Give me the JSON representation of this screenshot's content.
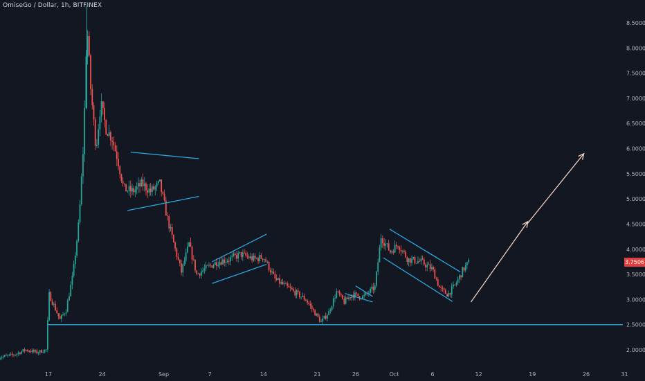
{
  "header": {
    "symbol_title": "OmiseGo / Dollar, 1h, BITFINEX"
  },
  "last_price": {
    "label": "3.7506",
    "value": 3.7506,
    "color": "#e03e3e"
  },
  "colors": {
    "background": "#131722",
    "up_candle": "#26a69a",
    "down_candle": "#ef5350",
    "trendline": "#2aa5e0",
    "projection_arrow": "#f0d0c0",
    "axis_text": "#b2b5be"
  },
  "chart_data": {
    "type": "candlestick",
    "title": "OmiseGo / Dollar, 1h, BITFINEX",
    "y_axis_ticks": [
      "2.0000",
      "2.5000",
      "3.0000",
      "3.5000",
      "4.0000",
      "4.5000",
      "5.0000",
      "5.5000",
      "6.0000",
      "6.5000",
      "7.0000",
      "7.5000",
      "8.0000",
      "8.5000"
    ],
    "y_axis_values": [
      2.0,
      2.5,
      3.0,
      3.5,
      4.0,
      4.5,
      5.0,
      5.5,
      6.0,
      6.5,
      7.0,
      7.5,
      8.0,
      8.5
    ],
    "ylim": [
      1.8,
      8.9
    ],
    "x_axis_ticks": [
      "17",
      "24",
      "Sep",
      "7",
      "14",
      "21",
      "26",
      "Oct",
      "6",
      "12",
      "19",
      "26",
      "31"
    ],
    "x_axis_day_index": [
      0,
      7,
      15,
      21,
      28,
      35,
      40,
      45,
      50,
      56,
      63,
      70,
      75
    ],
    "xlim_day_index": [
      -7,
      77
    ],
    "price_path": [
      {
        "d": -6.5,
        "p": 1.85
      },
      {
        "d": -4.5,
        "p": 1.9
      },
      {
        "d": -3,
        "p": 2.0
      },
      {
        "d": -1.5,
        "p": 1.95
      },
      {
        "d": -0.3,
        "p": 2.0
      },
      {
        "d": 0.1,
        "p": 3.1
      },
      {
        "d": 0.8,
        "p": 2.85
      },
      {
        "d": 1.5,
        "p": 2.6
      },
      {
        "d": 2.3,
        "p": 2.8
      },
      {
        "d": 3.2,
        "p": 3.5
      },
      {
        "d": 4.0,
        "p": 4.6
      },
      {
        "d": 4.6,
        "p": 6.2
      },
      {
        "d": 5.0,
        "p": 8.5
      },
      {
        "d": 5.5,
        "p": 7.2
      },
      {
        "d": 6.2,
        "p": 6.0
      },
      {
        "d": 6.8,
        "p": 6.9
      },
      {
        "d": 7.5,
        "p": 6.4
      },
      {
        "d": 8.3,
        "p": 6.2
      },
      {
        "d": 9.0,
        "p": 5.8
      },
      {
        "d": 9.8,
        "p": 5.2
      },
      {
        "d": 11,
        "p": 5.15
      },
      {
        "d": 12.2,
        "p": 5.3
      },
      {
        "d": 13.3,
        "p": 5.15
      },
      {
        "d": 14.5,
        "p": 5.3
      },
      {
        "d": 15.5,
        "p": 4.6
      },
      {
        "d": 16.5,
        "p": 4.0
      },
      {
        "d": 17.3,
        "p": 3.55
      },
      {
        "d": 18.3,
        "p": 4.1
      },
      {
        "d": 19.3,
        "p": 3.5
      },
      {
        "d": 20.3,
        "p": 3.6
      },
      {
        "d": 22,
        "p": 3.75
      },
      {
        "d": 23.5,
        "p": 3.8
      },
      {
        "d": 25,
        "p": 3.9
      },
      {
        "d": 26.8,
        "p": 3.8
      },
      {
        "d": 28,
        "p": 3.85
      },
      {
        "d": 29.5,
        "p": 3.4
      },
      {
        "d": 31.5,
        "p": 3.2
      },
      {
        "d": 33.5,
        "p": 3.0
      },
      {
        "d": 35.5,
        "p": 2.55
      },
      {
        "d": 36.5,
        "p": 2.75
      },
      {
        "d": 37.5,
        "p": 3.15
      },
      {
        "d": 38.5,
        "p": 2.95
      },
      {
        "d": 39.5,
        "p": 3.1
      },
      {
        "d": 41,
        "p": 3.05
      },
      {
        "d": 42.5,
        "p": 3.25
      },
      {
        "d": 43.3,
        "p": 4.25
      },
      {
        "d": 44.5,
        "p": 3.95
      },
      {
        "d": 45.5,
        "p": 4.1
      },
      {
        "d": 46.8,
        "p": 3.8
      },
      {
        "d": 48.5,
        "p": 3.75
      },
      {
        "d": 50,
        "p": 3.6
      },
      {
        "d": 51,
        "p": 3.2
      },
      {
        "d": 52,
        "p": 3.1
      },
      {
        "d": 53,
        "p": 3.3
      },
      {
        "d": 54,
        "p": 3.6
      },
      {
        "d": 54.8,
        "p": 3.75
      }
    ],
    "annotations": {
      "support_line": {
        "price": 2.5,
        "from_day": 0.0,
        "to_day": 77
      },
      "trend_lines": [
        {
          "from": {
            "d": 10.7,
            "p": 5.93
          },
          "to": {
            "d": 19.6,
            "p": 5.8
          }
        },
        {
          "from": {
            "d": 10.3,
            "p": 4.77
          },
          "to": {
            "d": 19.6,
            "p": 5.05
          }
        },
        {
          "from": {
            "d": 21.3,
            "p": 3.75
          },
          "to": {
            "d": 28.4,
            "p": 4.3
          }
        },
        {
          "from": {
            "d": 21.3,
            "p": 3.32
          },
          "to": {
            "d": 28.4,
            "p": 3.7
          }
        },
        {
          "from": {
            "d": 40.0,
            "p": 3.27
          },
          "to": {
            "d": 42.2,
            "p": 3.06
          }
        },
        {
          "from": {
            "d": 38.6,
            "p": 3.12
          },
          "to": {
            "d": 42.2,
            "p": 2.95
          }
        },
        {
          "from": {
            "d": 44.4,
            "p": 4.4
          },
          "to": {
            "d": 53.6,
            "p": 3.55
          }
        },
        {
          "from": {
            "d": 43.6,
            "p": 3.83
          },
          "to": {
            "d": 52.6,
            "p": 2.96
          }
        }
      ],
      "projection_arrows": [
        {
          "from": {
            "d": 55.0,
            "p": 2.95
          },
          "to": {
            "d": 62.4,
            "p": 4.55
          }
        },
        {
          "from": {
            "d": 62.3,
            "p": 4.5
          },
          "to": {
            "d": 69.7,
            "p": 5.9
          }
        }
      ]
    }
  }
}
